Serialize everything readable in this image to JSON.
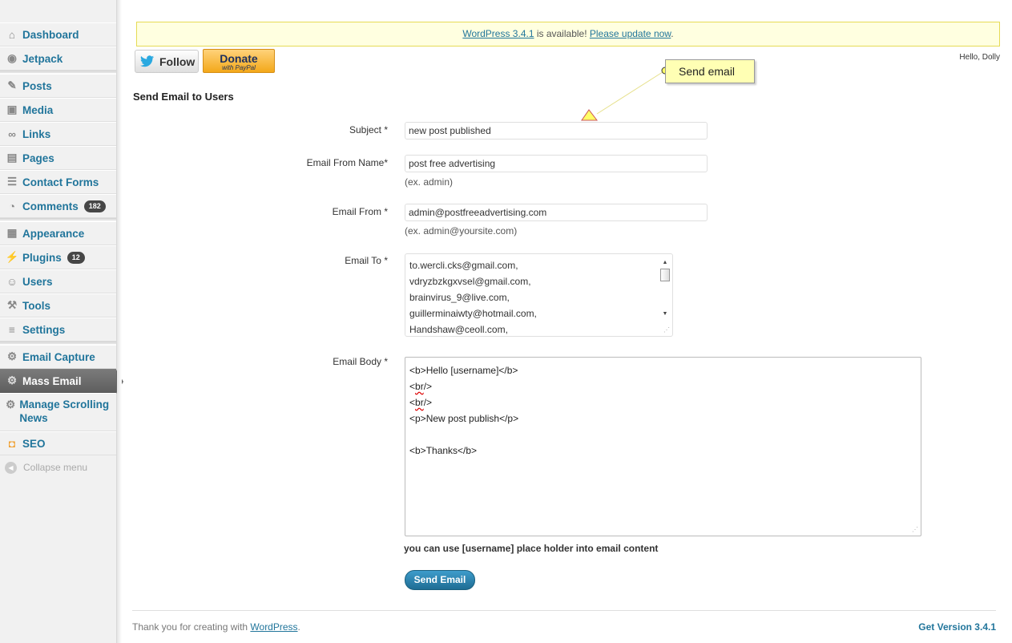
{
  "sidebar": {
    "groups": [
      [
        {
          "label": "Dashboard",
          "icon": "dashboard-icon"
        },
        {
          "label": "Jetpack",
          "icon": "jetpack-icon"
        }
      ],
      [
        {
          "label": "Posts",
          "icon": "posts-icon"
        },
        {
          "label": "Media",
          "icon": "media-icon"
        },
        {
          "label": "Links",
          "icon": "links-icon"
        },
        {
          "label": "Pages",
          "icon": "pages-icon"
        },
        {
          "label": "Contact Forms",
          "icon": "contact-forms-icon"
        },
        {
          "label": "Comments",
          "icon": "comments-icon",
          "count": "182"
        }
      ],
      [
        {
          "label": "Appearance",
          "icon": "appearance-icon"
        },
        {
          "label": "Plugins",
          "icon": "plugins-icon",
          "count": "12"
        },
        {
          "label": "Users",
          "icon": "users-icon"
        },
        {
          "label": "Tools",
          "icon": "tools-icon"
        },
        {
          "label": "Settings",
          "icon": "settings-icon"
        }
      ],
      [
        {
          "label": "Email Capture",
          "icon": "gear-icon"
        },
        {
          "label": "Mass Email",
          "icon": "gear-icon",
          "current": true
        },
        {
          "label": "Manage Scrolling News",
          "icon": "gear-icon",
          "tall": true
        },
        {
          "label": "SEO",
          "icon": "seo-icon"
        }
      ]
    ],
    "collapse_label": "Collapse menu"
  },
  "notice": {
    "version_link": "WordPress 3.4.1",
    "middle_text": " is available! ",
    "update_link": "Please update now",
    "end_text": "."
  },
  "top": {
    "follow_label": "Follow",
    "donate_label": "Donate",
    "donate_sub": "with PayPal",
    "howdy": "Hello, Dolly"
  },
  "callout": {
    "text": "Send email"
  },
  "form": {
    "title": "Send Email to Users",
    "subject_label": "Subject *",
    "subject_value": "new post published",
    "from_name_label": "Email From Name*",
    "from_name_value": "post free advertising",
    "from_name_hint": "(ex. admin)",
    "from_label": "Email From *",
    "from_value": "admin@postfreeadvertising.com",
    "from_hint": "(ex. admin@yoursite.com)",
    "to_label": "Email To *",
    "to_lines": [
      "to.wercli.cks@gmail.com,",
      "vdryzbzkgxvsel@gmail.com,",
      "brainvirus_9@live.com,",
      "guillerminaiwty@hotmail.com,",
      "Handshaw@ceoll.com,"
    ],
    "body_label": "Email Body *",
    "body_lines": [
      "<b>Hello [username]</b>",
      "<br/>",
      "<br/>",
      "<p>New post publish</p>",
      "",
      "<b>Thanks</b>"
    ],
    "note": "you can use [username] place holder into email content",
    "send_label": "Send Email"
  },
  "footer": {
    "left_text": "Thank you for creating with ",
    "left_link": "WordPress",
    "left_end": ".",
    "right": "Get Version 3.4.1"
  },
  "colors": {
    "link": "#21759b",
    "notice_bg": "#ffffe0",
    "callout_bg": "#ffffb4"
  }
}
